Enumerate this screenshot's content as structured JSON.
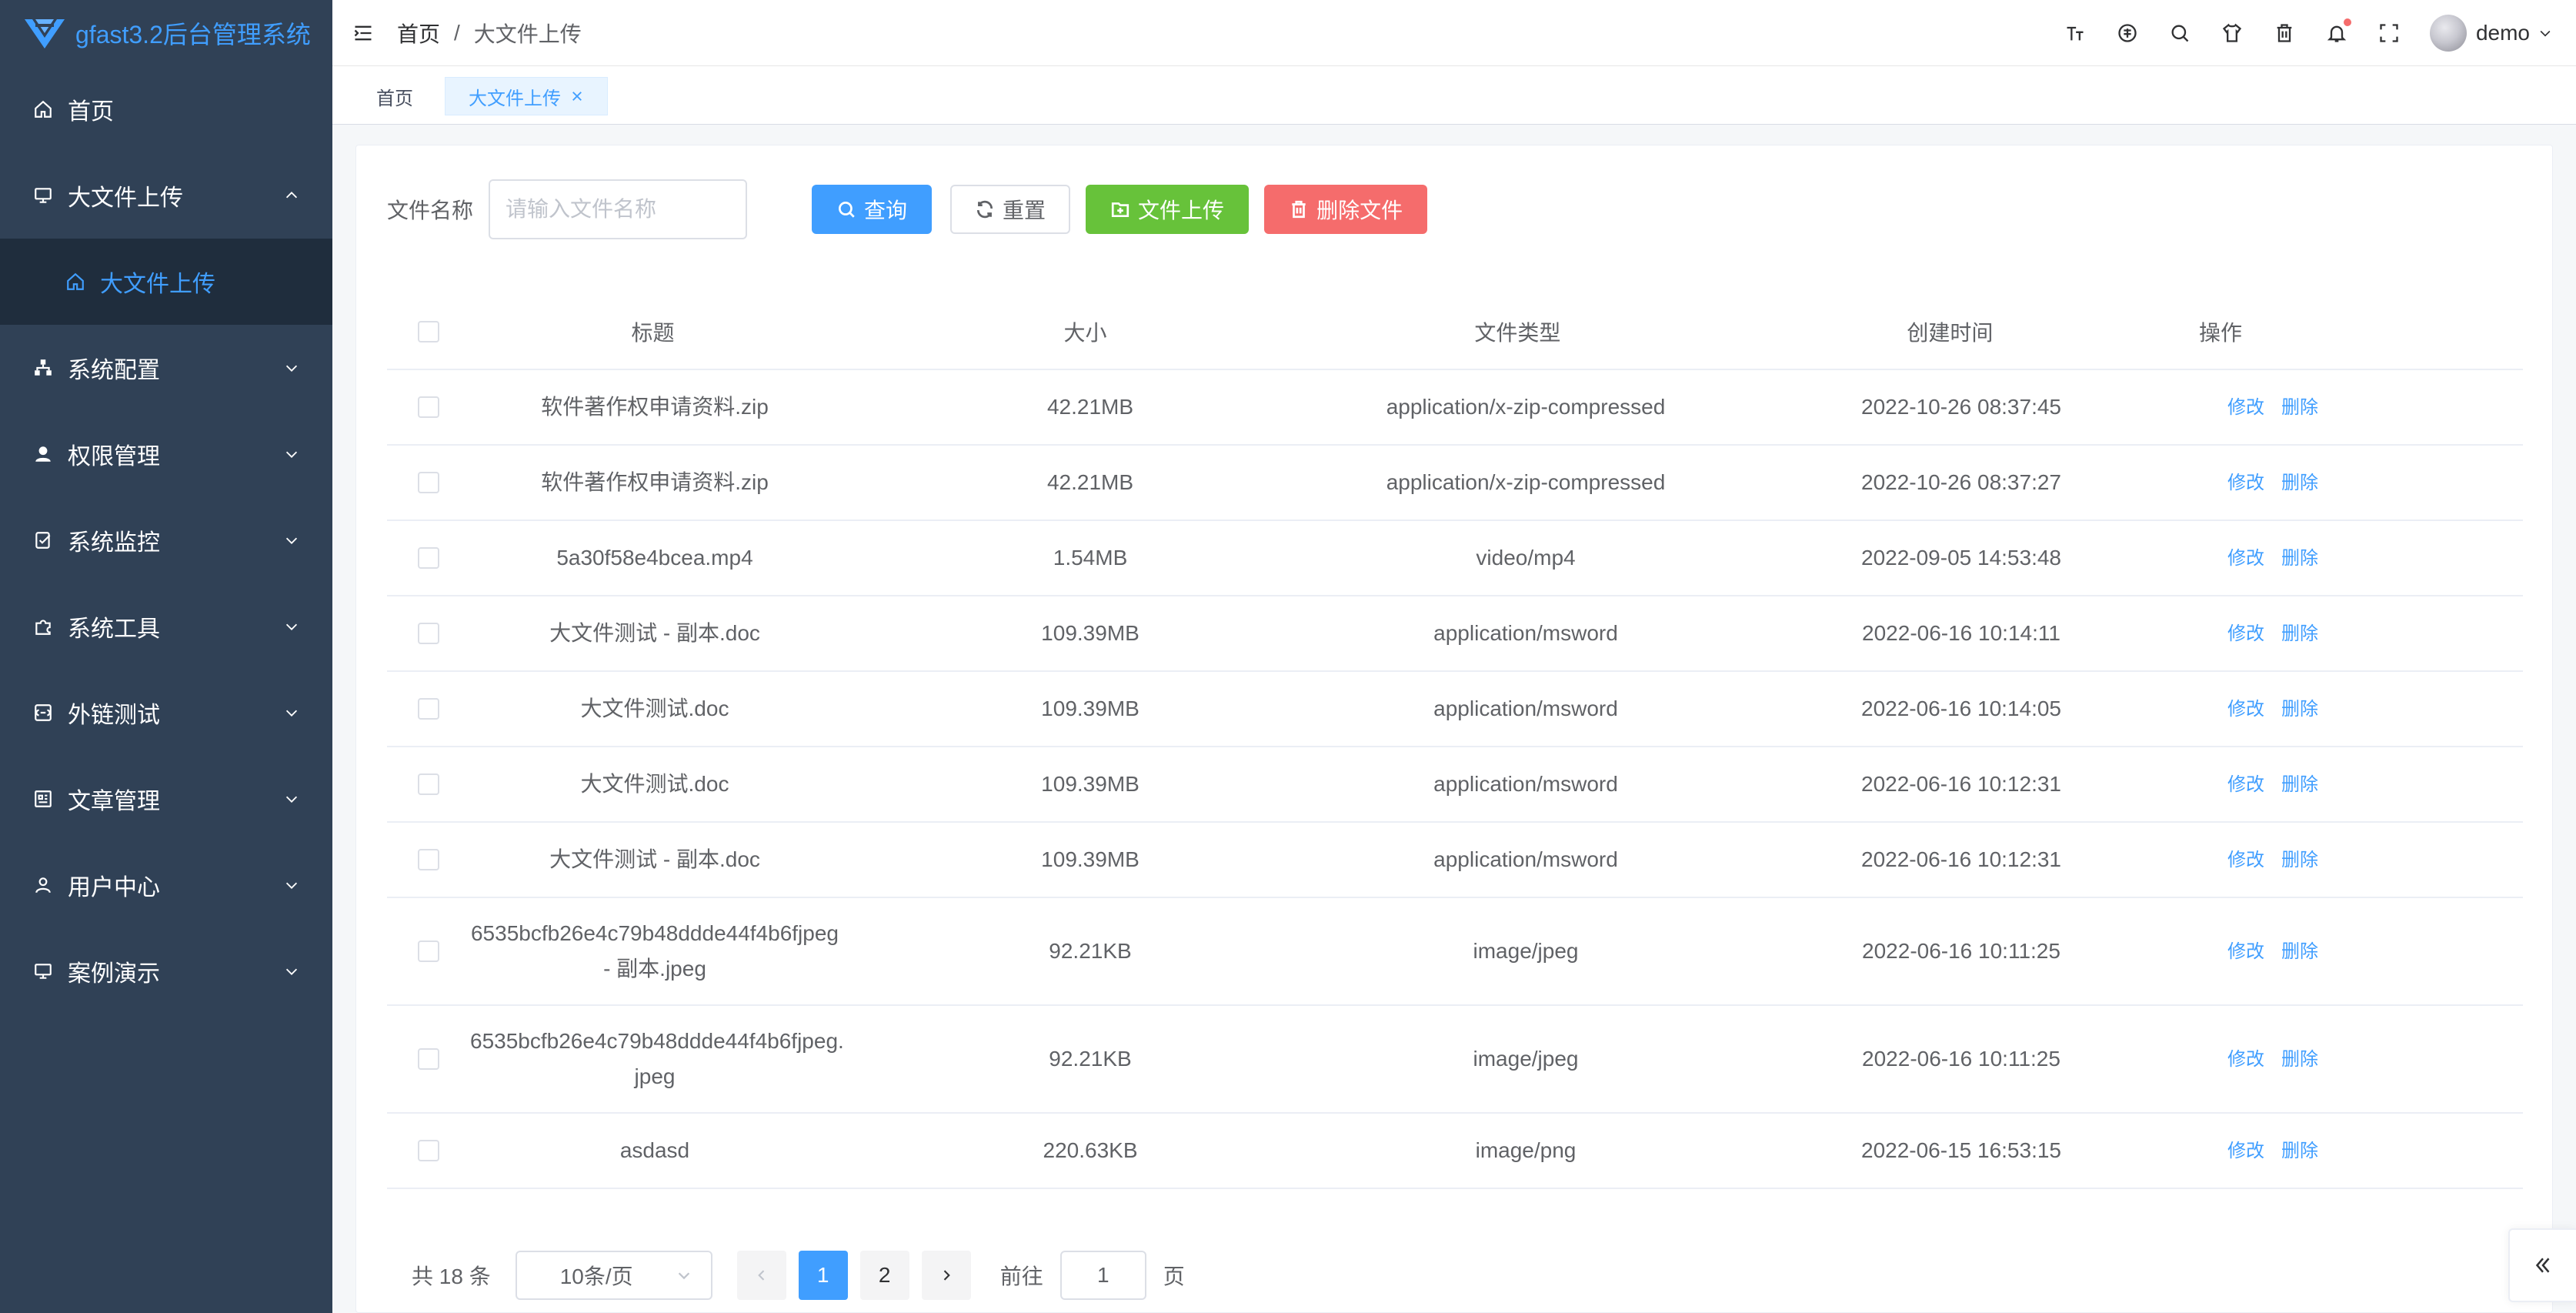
{
  "app": {
    "title": "gfast3.2后台管理系统"
  },
  "sidebar": {
    "items": [
      {
        "label": "首页",
        "icon": "home-icon"
      },
      {
        "label": "大文件上传",
        "icon": "monitor-icon",
        "expanded": true,
        "children": [
          {
            "label": "大文件上传",
            "icon": "home-icon"
          }
        ]
      },
      {
        "label": "系统配置",
        "icon": "sitemap-icon"
      },
      {
        "label": "权限管理",
        "icon": "user-fill-icon"
      },
      {
        "label": "系统监控",
        "icon": "monitor-check-icon"
      },
      {
        "label": "系统工具",
        "icon": "puzzle-icon"
      },
      {
        "label": "外链测试",
        "icon": "link-box-icon"
      },
      {
        "label": "文章管理",
        "icon": "article-icon"
      },
      {
        "label": "用户中心",
        "icon": "user-icon"
      },
      {
        "label": "案例演示",
        "icon": "monitor-icon"
      }
    ]
  },
  "header": {
    "breadcrumb": [
      "首页",
      "大文件上传"
    ],
    "separator": "/",
    "icons": [
      "font-size-icon",
      "language-icon",
      "search-icon",
      "skin-icon",
      "trash-icon",
      "bell-icon",
      "fullscreen-icon"
    ],
    "user": "demo"
  },
  "tags": [
    {
      "label": "首页",
      "active": false
    },
    {
      "label": "大文件上传",
      "active": true
    }
  ],
  "search": {
    "label": "文件名称",
    "placeholder": "请输入文件名称",
    "query_btn": "查询",
    "reset_btn": "重置",
    "upload_btn": "文件上传",
    "delete_btn": "删除文件"
  },
  "table": {
    "columns": [
      "标题",
      "大小",
      "文件类型",
      "创建时间",
      "操作"
    ],
    "rows": [
      {
        "title": [
          "软件著作权申请资料.zip"
        ],
        "size": "42.21MB",
        "type": "application/x-zip-compressed",
        "created": "2022-10-26 08:37:45"
      },
      {
        "title": [
          "软件著作权申请资料.zip"
        ],
        "size": "42.21MB",
        "type": "application/x-zip-compressed",
        "created": "2022-10-26 08:37:27"
      },
      {
        "title": [
          "5a30f58e4bcea.mp4"
        ],
        "size": "1.54MB",
        "type": "video/mp4",
        "created": "2022-09-05 14:53:48"
      },
      {
        "title": [
          "大文件测试 - 副本.doc"
        ],
        "size": "109.39MB",
        "type": "application/msword",
        "created": "2022-06-16 10:14:11"
      },
      {
        "title": [
          "大文件测试.doc"
        ],
        "size": "109.39MB",
        "type": "application/msword",
        "created": "2022-06-16 10:14:05"
      },
      {
        "title": [
          "大文件测试.doc"
        ],
        "size": "109.39MB",
        "type": "application/msword",
        "created": "2022-06-16 10:12:31"
      },
      {
        "title": [
          "大文件测试 - 副本.doc"
        ],
        "size": "109.39MB",
        "type": "application/msword",
        "created": "2022-06-16 10:12:31"
      },
      {
        "title": [
          "6535bcfb26e4c79b48ddde44f4b6fjpeg",
          "- 副本.jpeg"
        ],
        "size": "92.21KB",
        "type": "image/jpeg",
        "created": "2022-06-16 10:11:25"
      },
      {
        "title": [
          "6535bcfb26e4c79b48ddde44f4b6fjpeg.",
          "jpeg"
        ],
        "size": "92.21KB",
        "type": "image/jpeg",
        "created": "2022-06-16 10:11:25"
      },
      {
        "title": [
          "asdasd"
        ],
        "size": "220.63KB",
        "type": "image/png",
        "created": "2022-06-15 16:53:15"
      }
    ],
    "actions": {
      "edit": "修改",
      "delete": "删除"
    }
  },
  "pagination": {
    "total": "共 18 条",
    "page_size": "10条/页",
    "pages": [
      "1",
      "2"
    ],
    "current": "1",
    "goto_prefix": "前往",
    "goto_value": "1",
    "goto_suffix": "页"
  },
  "colors": {
    "sidebar_bg": "#304156",
    "submenu_bg": "#1f2d3d",
    "primary": "#409eff",
    "success": "#67c23a",
    "danger": "#f56c6c"
  }
}
